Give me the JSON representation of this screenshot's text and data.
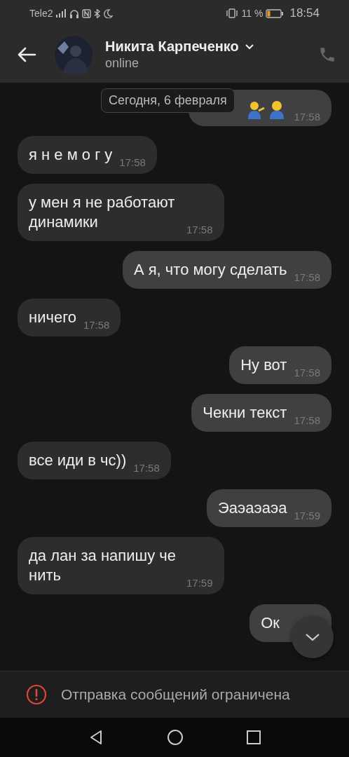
{
  "status_bar": {
    "carrier": "Tele2",
    "battery": "11 %",
    "time": "18:54"
  },
  "header": {
    "name": "Никита Карпеченко",
    "status": "online"
  },
  "date_pill": "Сегодня, 6 февраля",
  "messages": [
    {
      "kind": "outgoing",
      "emoji": true,
      "time": "17:58"
    },
    {
      "kind": "incoming",
      "text": "я н е м о г у",
      "time": "17:58"
    },
    {
      "kind": "incoming",
      "text": "у мен я не работают динамики",
      "time": "17:58"
    },
    {
      "kind": "outgoing",
      "text": "А я, что могу сделать",
      "time": "17:58"
    },
    {
      "kind": "incoming",
      "text": "ничего",
      "time": "17:58"
    },
    {
      "kind": "outgoing",
      "text": "Ну вот",
      "time": "17:58"
    },
    {
      "kind": "outgoing",
      "text": "Чекни текст",
      "time": "17:58"
    },
    {
      "kind": "incoming",
      "text": "все иди в чс))",
      "time": "17:58"
    },
    {
      "kind": "outgoing",
      "text": "Эаэаэаэа",
      "time": "17:59"
    },
    {
      "kind": "incoming",
      "text": "да лан за напишу че нить",
      "time": "17:59"
    },
    {
      "kind": "outgoing",
      "text": "Ок"
    }
  ],
  "restriction": "Отправка сообщений ограничена"
}
